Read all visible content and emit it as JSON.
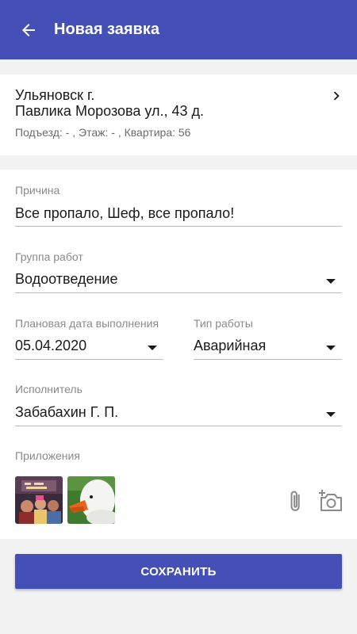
{
  "appbar": {
    "title": "Новая заявка",
    "back_icon": "arrow-left-icon",
    "color": "#4450b8"
  },
  "address": {
    "city": "Ульяновск г.",
    "street": "Павлика Морозова ул., 43 д.",
    "details": "Подъезд: - , Этаж: - , Квартира: 56",
    "chevron_icon": "chevron-right-icon"
  },
  "form": {
    "reason": {
      "label": "Причина",
      "value": "Все пропало, Шеф, все пропало!"
    },
    "work_group": {
      "label": "Группа работ",
      "value": "Водоотведение"
    },
    "planned_date": {
      "label": "Плановая дата выполнения",
      "value": "05.04.2020"
    },
    "work_type": {
      "label": "Тип работы",
      "value": "Аварийная"
    },
    "executor": {
      "label": "Исполнитель",
      "value": "Забабахин Г. П."
    },
    "attachments": {
      "label": "Приложения",
      "items": [
        {
          "icon": "birthday-photo-thumbnail"
        },
        {
          "icon": "goose-photo-thumbnail"
        }
      ],
      "attach_icon": "paperclip-icon",
      "camera_icon": "add-photo-camera-icon"
    }
  },
  "actions": {
    "save_label": "СОХРАНИТЬ",
    "accent": "#4450b8"
  }
}
